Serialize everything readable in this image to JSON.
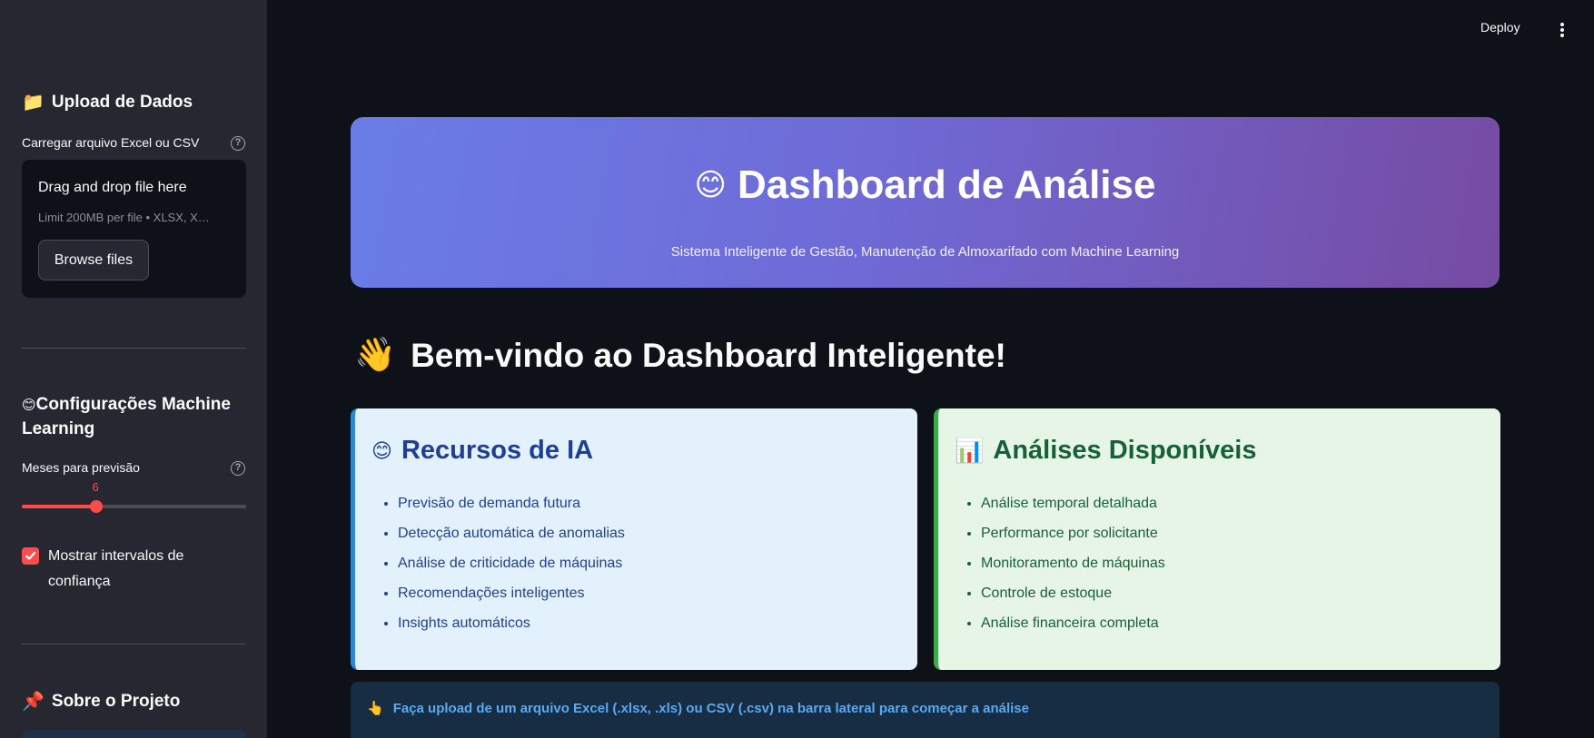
{
  "header": {
    "deploy_label": "Deploy",
    "menu_icon": "kebab-menu-icon"
  },
  "sidebar": {
    "upload_section": {
      "icon": "📁",
      "title": "Upload de Dados",
      "field_label": "Carregar arquivo Excel ou CSV",
      "dropzone_title": "Drag and drop file here",
      "dropzone_limit": "Limit 200MB per file • XLSX, X…",
      "browse_label": "Browse files"
    },
    "ml_section": {
      "icon": "😊",
      "title": "Configurações Machine Learning",
      "slider_label": "Meses para previsão",
      "slider_value": "6",
      "slider_fraction": 0.33,
      "checkbox_label": "Mostrar intervalos de confiança",
      "checkbox_checked": true
    },
    "about_section": {
      "icon": "📌",
      "title": "Sobre o Projeto"
    }
  },
  "main": {
    "hero": {
      "icon": "😊",
      "title": "Dashboard de Análise",
      "subtitle": "Sistema Inteligente de Gestão, Manutenção de Almoxarifado com Machine Learning"
    },
    "welcome": {
      "icon": "👋",
      "title": "Bem-vindo ao Dashboard Inteligente!"
    },
    "ai_card": {
      "icon": "😊",
      "title": "Recursos de IA",
      "items": [
        "Previsão de demanda futura",
        "Detecção automática de anomalias",
        "Análise de criticidade de máquinas",
        "Recomendações inteligentes",
        "Insights automáticos"
      ]
    },
    "analysis_card": {
      "icon": "📊",
      "title": "Análises Disponíveis",
      "items": [
        "Análise temporal detalhada",
        "Performance por solicitante",
        "Monitoramento de máquinas",
        "Controle de estoque",
        "Análise financeira completa"
      ]
    },
    "info": {
      "icon": "👆",
      "text": "Faça upload de um arquivo Excel (.xlsx, .xls) ou CSV (.csv) na barra lateral para começar a análise"
    }
  },
  "colors": {
    "accent": "#ff4b4b",
    "hero_start": "#667eea",
    "hero_end": "#764ba2",
    "ai_card_bg": "#e3f1fc",
    "analysis_card_bg": "#e6f5e6",
    "info_text": "#5aa9f2"
  }
}
